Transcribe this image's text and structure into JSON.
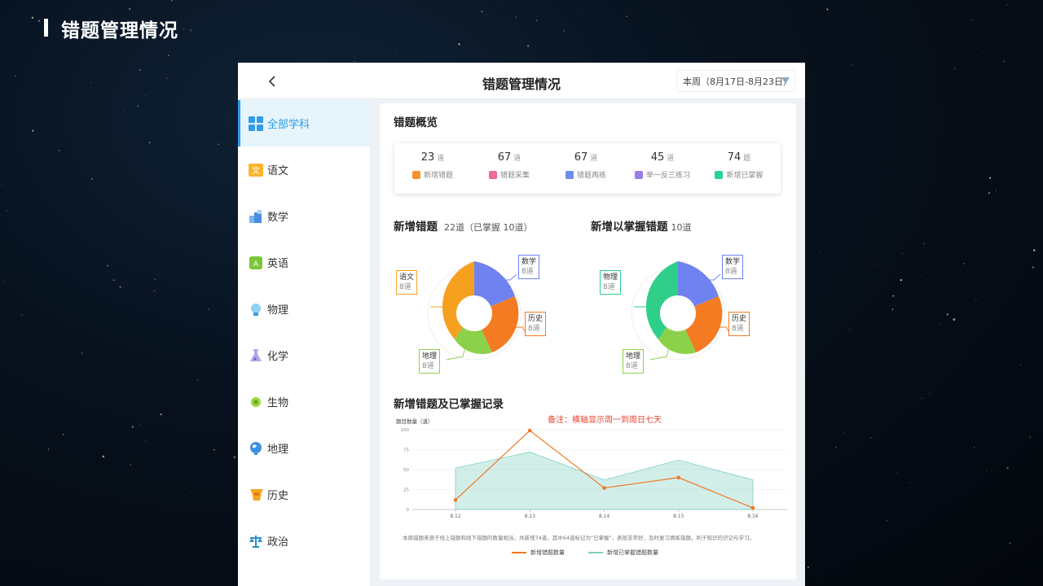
{
  "slide": {
    "title": "错题管理情况"
  },
  "topbar": {
    "title": "错题管理情况",
    "week_select": "本周（8月17日-8月23日）"
  },
  "sidebar": {
    "items": [
      {
        "label": "全部学科",
        "icon": "grid-icon",
        "active": true
      },
      {
        "label": "语文",
        "icon": "chinese-icon"
      },
      {
        "label": "数学",
        "icon": "math-icon"
      },
      {
        "label": "英语",
        "icon": "english-icon"
      },
      {
        "label": "物理",
        "icon": "physics-icon"
      },
      {
        "label": "化学",
        "icon": "chemistry-icon"
      },
      {
        "label": "生物",
        "icon": "biology-icon"
      },
      {
        "label": "地理",
        "icon": "globe-icon"
      },
      {
        "label": "历史",
        "icon": "history-icon"
      },
      {
        "label": "政治",
        "icon": "scales-icon"
      }
    ]
  },
  "overview": {
    "title": "错题概览",
    "stats": [
      {
        "value": "23",
        "unit": "道",
        "label": "新增错题",
        "color": "#f5932a"
      },
      {
        "value": "67",
        "unit": "道",
        "label": "错题采集",
        "color": "#ee6a9a"
      },
      {
        "value": "67",
        "unit": "道",
        "label": "错题再练",
        "color": "#6f8cf0"
      },
      {
        "value": "45",
        "unit": "道",
        "label": "举一反三练习",
        "color": "#9b7bea"
      },
      {
        "value": "74",
        "unit": "题",
        "label": "新增已掌握",
        "color": "#27d0a0"
      }
    ]
  },
  "donuts": {
    "left": {
      "title": "新增错题",
      "subtitle": "22道（已掌握  10道）",
      "callouts": [
        {
          "name": "语文",
          "value": "8道",
          "color": "#f7a020"
        },
        {
          "name": "数学",
          "value": "8道",
          "color": "#6f82f0"
        },
        {
          "name": "历史",
          "value": "8道",
          "color": "#f57b22"
        },
        {
          "name": "地理",
          "value": "8道",
          "color": "#8cd14a"
        }
      ]
    },
    "right": {
      "title": "新增以掌握错题",
      "subtitle": "10道",
      "callouts": [
        {
          "name": "物理",
          "value": "8道",
          "color": "#2fcf8a"
        },
        {
          "name": "数学",
          "value": "8道",
          "color": "#6f82f0"
        },
        {
          "name": "历史",
          "value": "8道",
          "color": "#f57b22"
        },
        {
          "name": "地理",
          "value": "8道",
          "color": "#8cd14a"
        }
      ]
    }
  },
  "record": {
    "title": "新增错题及已掌握记录",
    "note": "备注：横轴显示周一到周日七天",
    "description": "本周错题来源于线上错题和线下错题的数量相当，共新增74道，其中64道标记为\"已掌握\"，表现非常好，及时复习再练错题，利于知识的识记与学习。",
    "legend_new": "新增错题数量",
    "legend_mastered": "新增已掌握错题数量"
  },
  "chart_data": {
    "type": "line",
    "x": [
      "8.12",
      "8.13",
      "8.14",
      "8.15",
      "8.16"
    ],
    "ylabel": "题目数量（道）",
    "ylim": [
      0,
      100
    ],
    "yticks": [
      0,
      25,
      50,
      75,
      100
    ],
    "series": [
      {
        "name": "新增错题数量",
        "type": "line",
        "values": [
          12,
          99,
          27,
          40,
          2
        ],
        "color": "#f07722"
      },
      {
        "name": "新增已掌握错题数量",
        "type": "area",
        "values": [
          52,
          72,
          37,
          62,
          37
        ],
        "color": "#7fcfc0"
      }
    ]
  }
}
